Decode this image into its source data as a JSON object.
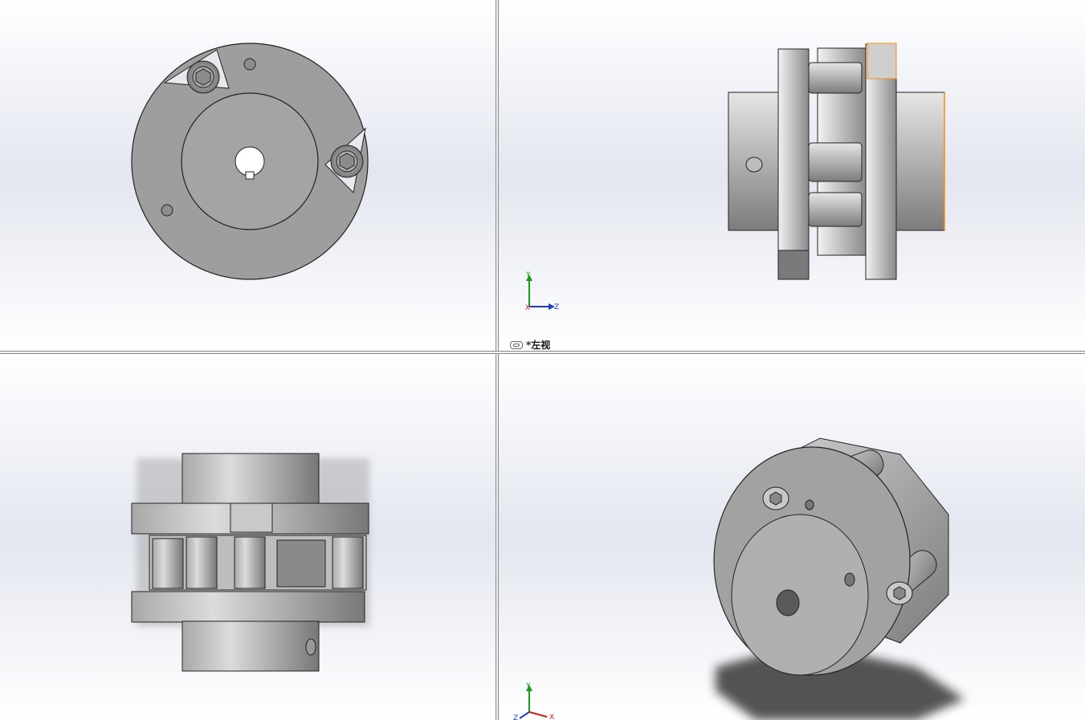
{
  "views": {
    "top_right": {
      "label": "*左视",
      "triad": {
        "y": "Y",
        "x": "X",
        "z": "Z"
      }
    },
    "bottom_right": {
      "triad": {
        "y": "Y",
        "x": "X",
        "z": "Z"
      }
    }
  },
  "colors": {
    "part_face": "#9a9a9a",
    "part_light": "#d8d8d8",
    "edge": "#2a2a2a",
    "highlight_edge": "#ff8a00",
    "axis_y": "#1a9a1a",
    "axis_z": "#1a3cc8",
    "axis_x": "#c81a1a"
  }
}
